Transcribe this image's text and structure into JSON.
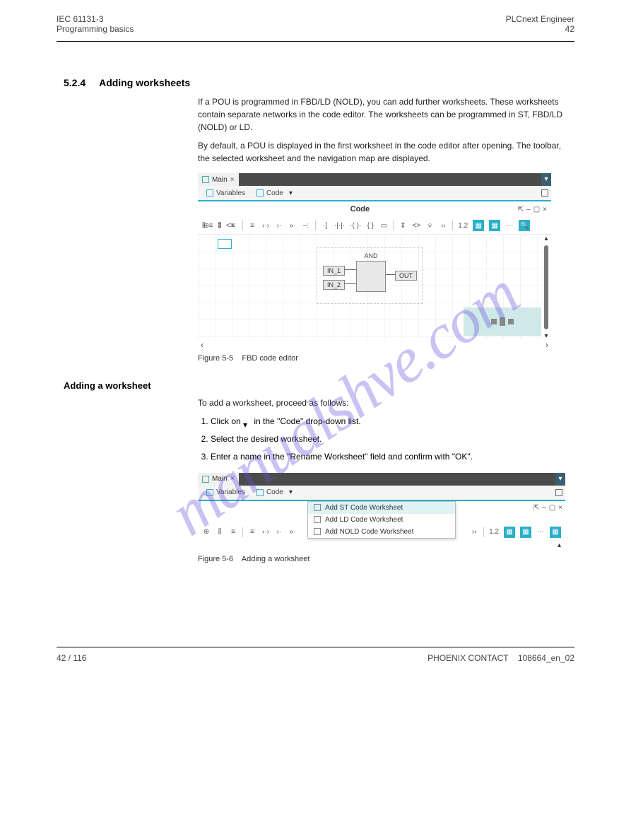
{
  "header": {
    "left_line1": "IEC 61131-3",
    "left_line2": "Programming basics",
    "right_line1": "PLCnext Engineer",
    "page_top": "42"
  },
  "watermark": "manualshve.com",
  "s1": {
    "h4_num": "5.2.4",
    "h4_title": "Adding worksheets",
    "para1": "If a POU is programmed in FBD/LD (NOLD), you can add further worksheets. These worksheets contain separate networks in the code editor. The worksheets can be programmed in ST, FBD/LD (NOLD) or LD.",
    "para2": "By default, a POU is displayed in the first worksheet in the code editor after opening. The toolbar, the selected worksheet and the navigation map are displayed."
  },
  "shot1": {
    "tab_main": "Main",
    "subtab_vars": "Variables",
    "subtab_code": "Code",
    "code_title": "Code",
    "zoom": "1.2",
    "and_label": "AND",
    "in1": "IN_1",
    "in2": "IN_2",
    "out": "OUT",
    "figcap": "Figure 5-5",
    "figtext": "FBD code editor"
  },
  "s2": {
    "h5": "Adding a worksheet",
    "intro": "To add a worksheet, proceed as follows:",
    "step1_a": "Click on",
    "step1_b": "in the \"Code\" drop-down list.",
    "step2": "Select the desired worksheet.",
    "step3": "Enter a name in the \"Rename Worksheet\" field and confirm with \"OK\"."
  },
  "shot2": {
    "tab_main": "Main",
    "subtab_vars": "Variables",
    "subtab_code": "Code",
    "menu_st": "Add ST Code Worksheet",
    "menu_ld": "Add LD Code Worksheet",
    "menu_nold": "Add NOLD Code Worksheet",
    "zoom": "1.2",
    "figcap": "Figure 5-6",
    "figtext": "Adding a worksheet"
  },
  "footer": {
    "left": "42 / 116",
    "right": "PHOENIX CONTACT",
    "doc": "108664_en_02"
  }
}
